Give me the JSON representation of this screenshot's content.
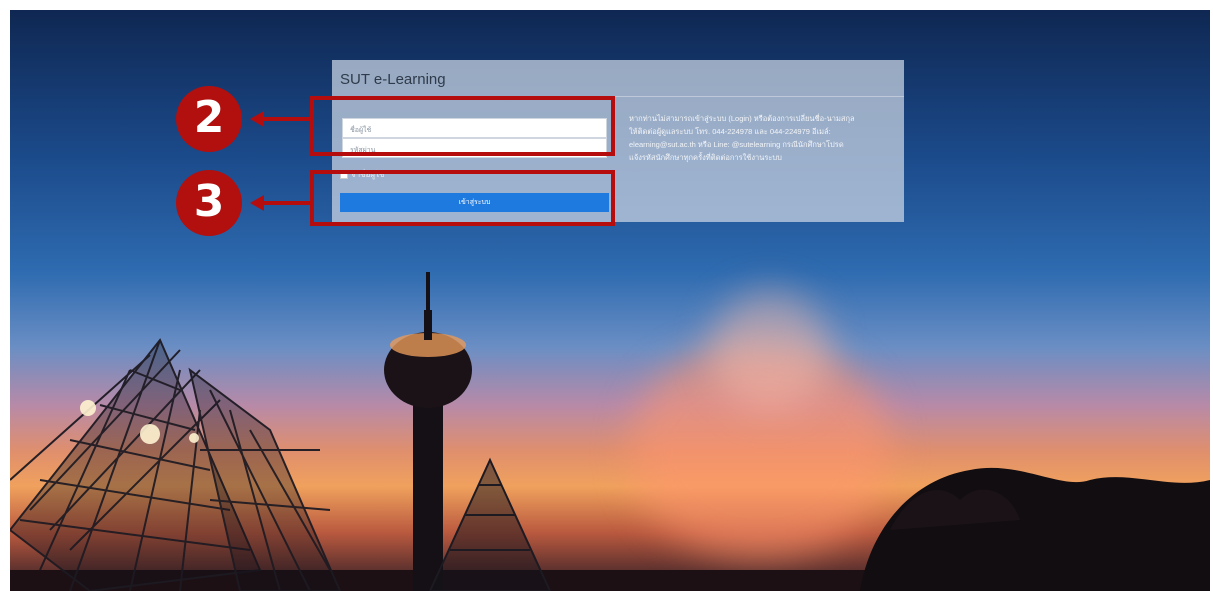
{
  "panel": {
    "title": "SUT e-Learning",
    "username_placeholder": "ชื่อผู้ใช้",
    "password_placeholder": "รหัสผ่าน",
    "remember_label": "จำชื่อผู้ใช้",
    "login_label": "เข้าสู่ระบบ",
    "info_lines": [
      "หากท่านไม่สามารถเข้าสู่ระบบ (Login) หรือต้องการเปลี่ยนชื่อ-นามสกุล",
      "ให้ติดต่อผู้ดูแลระบบ โทร. 044-224978 และ 044-224979 อีเมล์:",
      "elearning@sut.ac.th หรือ Line: @sutelearning กรณีนักศึกษาโปรด",
      "แจ้งรหัสนักศึกษาทุกครั้งที่ติดต่อการใช้งานระบบ"
    ]
  },
  "annotations": {
    "step_2": "2",
    "step_3": "3",
    "color": "#b50d0d"
  }
}
